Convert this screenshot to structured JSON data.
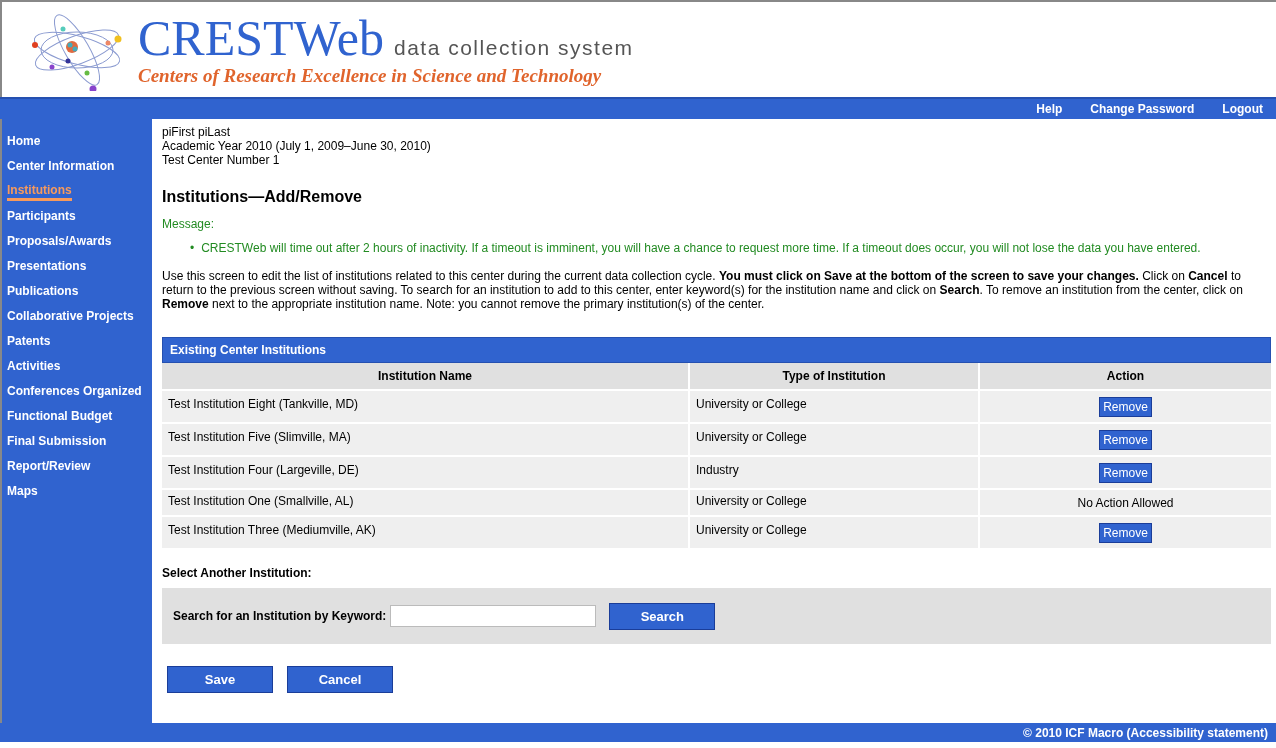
{
  "header": {
    "logo": "CRESTWeb",
    "tagline": "data collection system",
    "subtitle": "Centers of Research Excellence in Science and Technology"
  },
  "top_links": [
    "Help",
    "Change Password",
    "Logout"
  ],
  "sidebar": {
    "items": [
      {
        "label": "Home",
        "selected": false
      },
      {
        "label": "Center Information",
        "selected": false
      },
      {
        "label": "Institutions",
        "selected": true
      },
      {
        "label": "Participants",
        "selected": false
      },
      {
        "label": "Proposals/Awards",
        "selected": false
      },
      {
        "label": "Presentations",
        "selected": false
      },
      {
        "label": "Publications",
        "selected": false
      },
      {
        "label": "Collaborative Projects",
        "selected": false
      },
      {
        "label": "Patents",
        "selected": false
      },
      {
        "label": "Activities",
        "selected": false
      },
      {
        "label": "Conferences Organized",
        "selected": false
      },
      {
        "label": "Functional Budget",
        "selected": false
      },
      {
        "label": "Final Submission",
        "selected": false
      },
      {
        "label": "Report/Review",
        "selected": false
      },
      {
        "label": "Maps",
        "selected": false
      }
    ]
  },
  "user_info": [
    "piFirst piLast",
    "Academic Year 2010 (July 1, 2009–June 30, 2010)",
    "Test Center Number 1"
  ],
  "page_title": "Institutions—Add/Remove",
  "message": {
    "label": "Message:",
    "items": [
      {
        "marker": "•",
        "text": "CRESTWeb will time out after 2 hours of inactivity. If a timeout is imminent, you will have a chance to request more time. If a timeout does occur, you will not lose the data you have entered."
      }
    ]
  },
  "instructions": "Use this screen to edit the list of institutions related to this center during the current data collection cycle. **You must click on Save at the bottom of the screen to save your changes.** Click on **Cancel** to return to the previous screen without saving. To search for an institution to add to this center, enter keyword(s) for the institution name and click on **Search**. To remove an institution from the center, click on **Remove** next to the appropriate institution name. Note: you cannot remove the primary institution(s) of the center.",
  "table": {
    "title": "Existing Center Institutions",
    "columns": [
      "Institution Name",
      "Type of Institution",
      "Action"
    ],
    "rows": [
      {
        "name": "Test Institution Eight (Tankville, MD)",
        "type": "University or College",
        "action": {
          "kind": "button",
          "label": "Remove"
        }
      },
      {
        "name": "Test Institution Five (Slimville, MA)",
        "type": "University or College",
        "action": {
          "kind": "button",
          "label": "Remove"
        }
      },
      {
        "name": "Test Institution Four (Largeville, DE)",
        "type": "Industry",
        "action": {
          "kind": "button",
          "label": "Remove"
        }
      },
      {
        "name": "Test Institution One (Smallville, AL)",
        "type": "University or College",
        "action": {
          "kind": "text",
          "label": "No Action Allowed"
        }
      },
      {
        "name": "Test Institution Three (Mediumville, AK)",
        "type": "University or College",
        "action": {
          "kind": "button",
          "label": "Remove"
        }
      }
    ]
  },
  "select_heading": "Select Another Institution:",
  "search": {
    "label": "Search for an Institution by Keyword:",
    "button": "Search"
  },
  "buttons": [
    "Save",
    "Cancel"
  ],
  "footer": "© 2010 ICF Macro (Accessibility statement)"
}
